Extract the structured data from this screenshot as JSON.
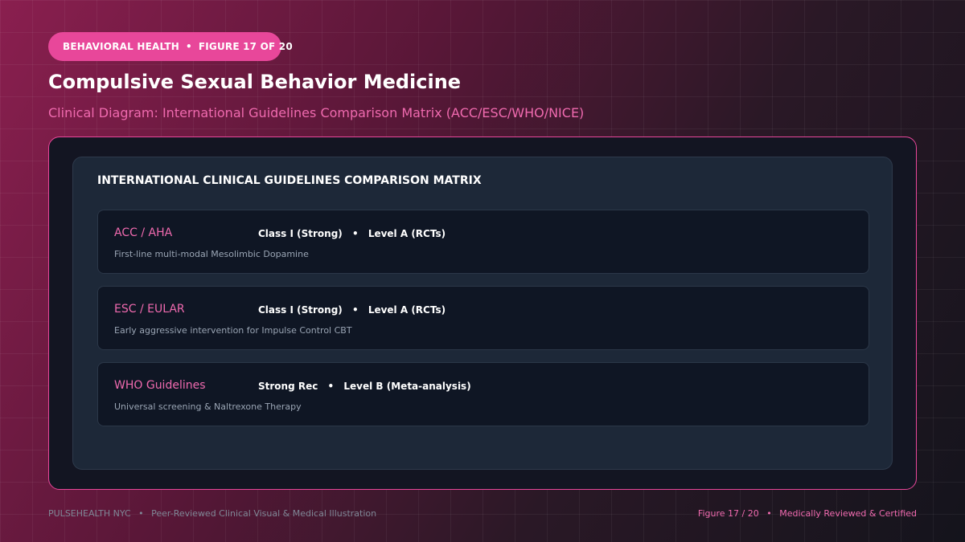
{
  "header": {
    "category": "BEHAVIORAL HEALTH",
    "figure_label": "FIGURE 17 OF 20",
    "title": "Compulsive Sexual Behavior Medicine",
    "subtitle": "Clinical Diagram: International Guidelines Comparison Matrix (ACC/ESC/WHO/NICE)"
  },
  "panel": {
    "title": "INTERNATIONAL CLINICAL GUIDELINES COMPARISON MATRIX",
    "rows": [
      {
        "name": "ACC / AHA",
        "strength": "Class I (Strong)",
        "level": "Level A (RCTs)",
        "description": "First-line multi-modal Mesolimbic Dopamine"
      },
      {
        "name": "ESC / EULAR",
        "strength": "Class I (Strong)",
        "level": "Level A (RCTs)",
        "description": "Early aggressive intervention for Impulse Control CBT"
      },
      {
        "name": "WHO Guidelines",
        "strength": "Strong Rec",
        "level": "Level B (Meta-analysis)",
        "description": "Universal screening & Naltrexone Therapy"
      }
    ]
  },
  "footer": {
    "brand": "PULSEHEALTH NYC",
    "tagline": "Peer-Reviewed Clinical Visual & Medical Illustration",
    "figure": "Figure 17 / 20",
    "status": "Medically Reviewed & Certified"
  },
  "colors": {
    "accent": "#e8479a",
    "accent_text": "#f06aaf",
    "panel_bg": "#1d2838",
    "row_bg": "#0f1624"
  }
}
